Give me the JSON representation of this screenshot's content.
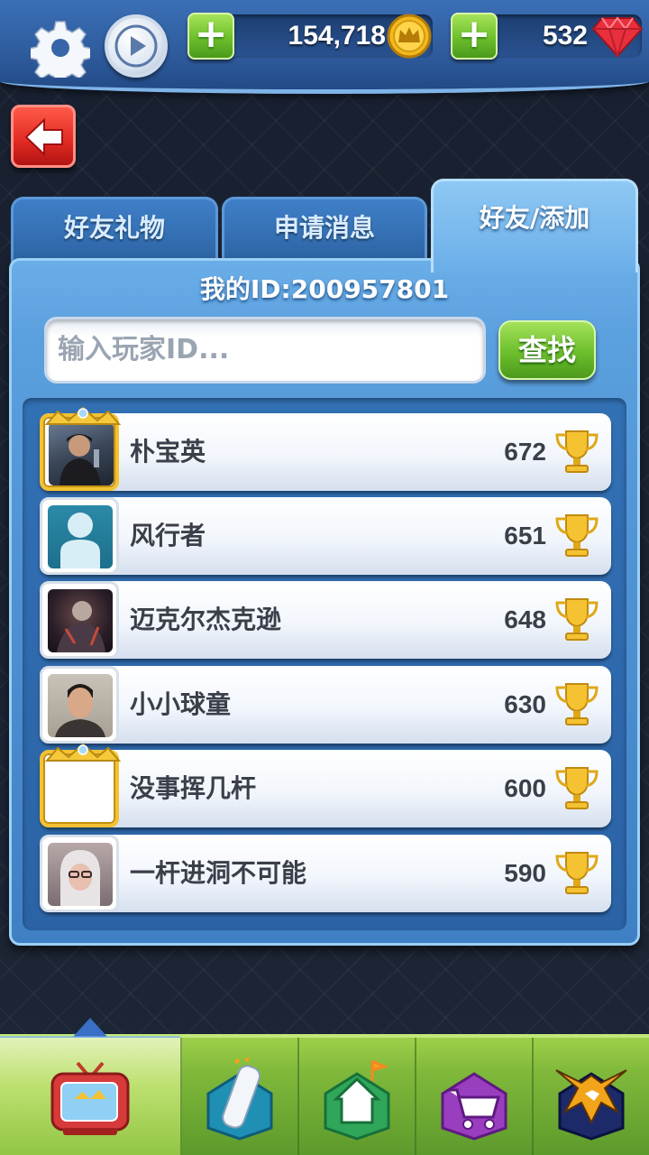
{
  "top_bar": {
    "coins": "154,718",
    "gems": "532",
    "add_symbol": "+"
  },
  "tabs": [
    {
      "label": "好友礼物",
      "active": false
    },
    {
      "label": "申请消息",
      "active": false
    },
    {
      "label": "好友/添加",
      "active": true
    }
  ],
  "panel": {
    "my_id": "我的ID:200957801",
    "search_placeholder": "输入玩家ID...",
    "search_button": "查找"
  },
  "friends": [
    {
      "name": "朴宝英",
      "score": "672",
      "frame": "gold-crown",
      "avatar": "photo-man-cap"
    },
    {
      "name": "风行者",
      "score": "651",
      "frame": "plain",
      "avatar": "default-silhouette"
    },
    {
      "name": "迈克尔杰克逊",
      "score": "648",
      "frame": "plain",
      "avatar": "photo-warrior"
    },
    {
      "name": "小小球童",
      "score": "630",
      "frame": "plain",
      "avatar": "photo-young-man"
    },
    {
      "name": "没事挥几杆",
      "score": "600",
      "frame": "gold-crown",
      "avatar": "empty"
    },
    {
      "name": "一杆进洞不可能",
      "score": "590",
      "frame": "plain",
      "avatar": "photo-woman-glasses"
    }
  ],
  "bottom_nav": [
    {
      "icon": "tv-icon",
      "selected": true
    },
    {
      "icon": "golf-bag-icon",
      "selected": false
    },
    {
      "icon": "home-icon",
      "selected": false
    },
    {
      "icon": "shopping-cart-icon",
      "selected": false
    },
    {
      "icon": "eagle-emblem-icon",
      "selected": false
    }
  ],
  "colors": {
    "accent_blue": "#3f7fc8",
    "accent_green": "#6cbe2c",
    "back_red": "#e02a22",
    "gold": "#f2c233"
  }
}
